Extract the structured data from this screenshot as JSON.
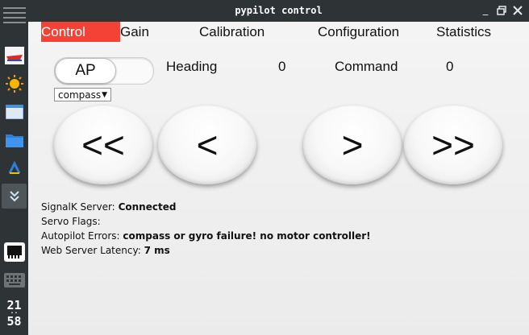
{
  "window": {
    "title": "pypilot control"
  },
  "tabs": [
    "Control",
    "Gain",
    "Calibration",
    "Configuration",
    "Statistics"
  ],
  "control": {
    "ap_toggle": "AP",
    "heading_label": "Heading",
    "heading_value": "0",
    "command_label": "Command",
    "command_value": "0",
    "mode_select": "compass",
    "buttons": [
      "<<",
      "<",
      ">",
      ">>"
    ]
  },
  "status": {
    "signalk_label": "SignalK Server:",
    "signalk_value": "Connected",
    "servo_flags_label": "Servo Flags:",
    "servo_flags_value": "",
    "ap_errors_label": "Autopilot Errors:",
    "ap_errors_value": "compass or gyro failure! no motor controller!",
    "latency_label": "Web Server Latency:",
    "latency_value": "7 ms"
  },
  "dock": {
    "icons": [
      "menu-icon",
      "boat-icon",
      "sun-icon",
      "window-icon",
      "folder-icon",
      "chart-icon",
      "download-icon",
      "network-icon",
      "keyboard-icon"
    ],
    "clock_hour": "21",
    "clock_minute": "58"
  },
  "colors": {
    "active_tab": "#f44336",
    "titlebar": "#2e3436"
  }
}
